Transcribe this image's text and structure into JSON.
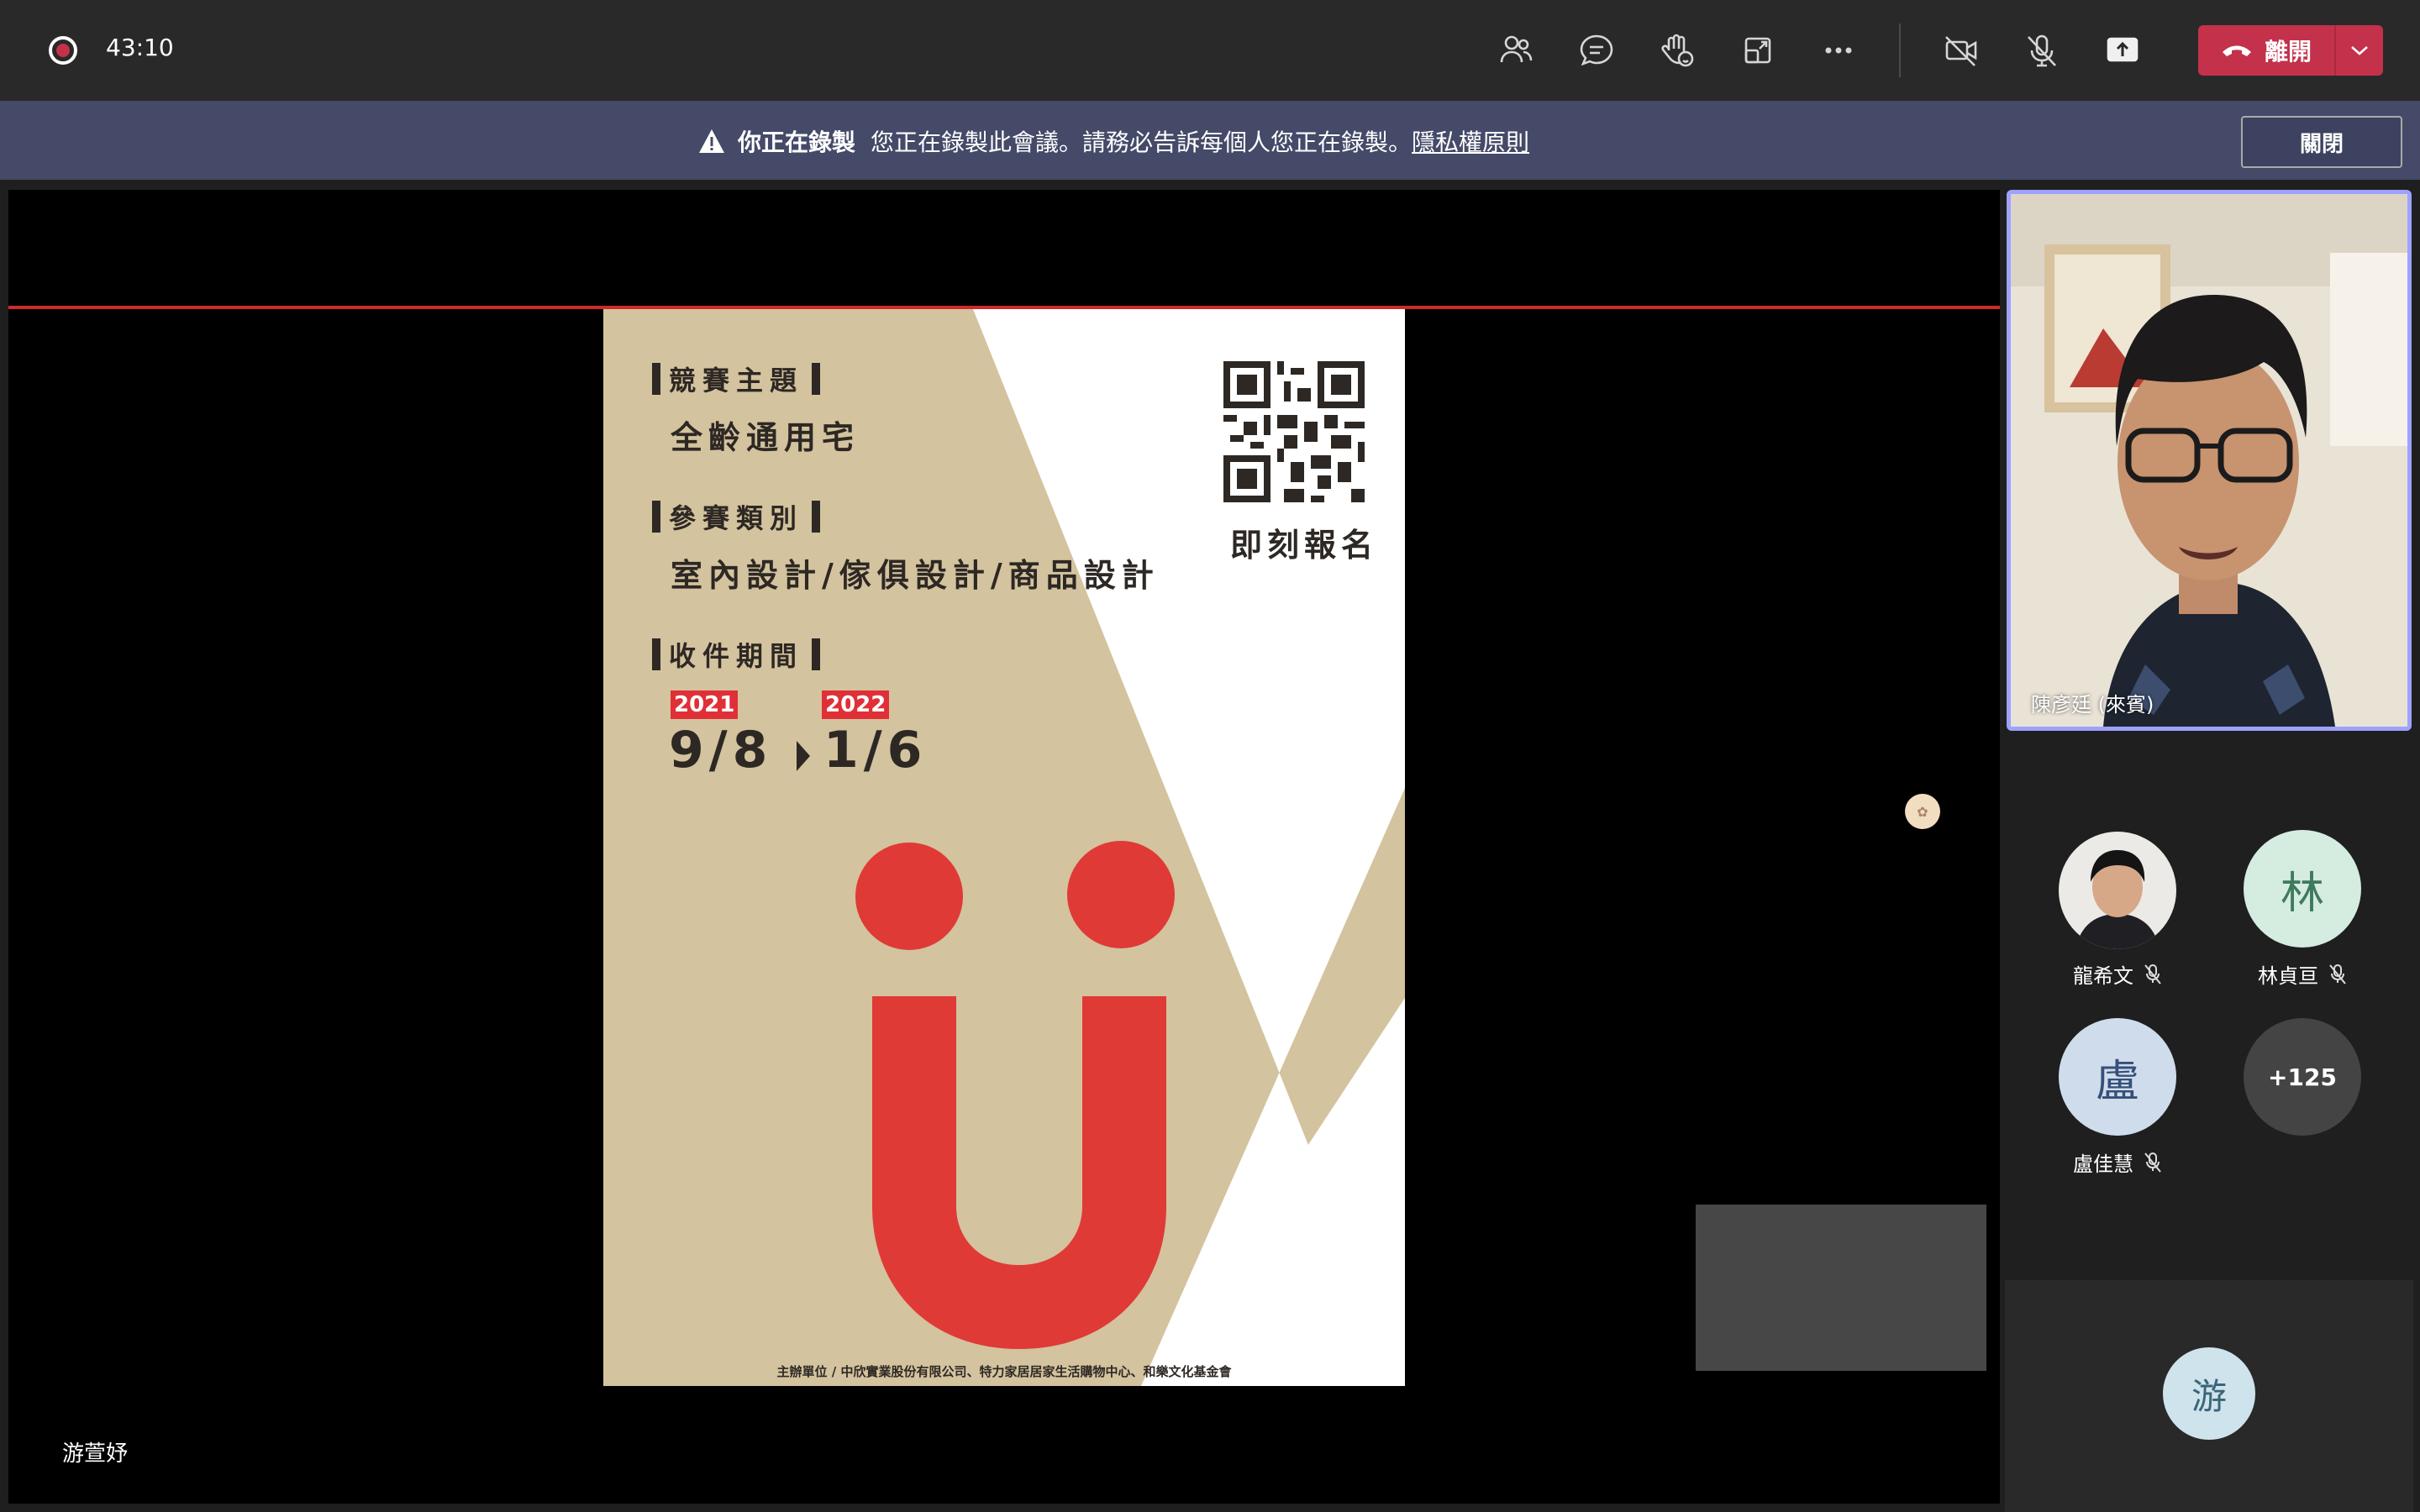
{
  "topbar": {
    "timer": "43:10",
    "leave_label": "離開",
    "icons": [
      "people-icon",
      "chat-icon",
      "raise-hand-icon",
      "share-tray-icon",
      "more-icon",
      "camera-off-icon",
      "mic-off-icon",
      "share-screen-icon"
    ]
  },
  "banner": {
    "title": "你正在錄製",
    "message": "您正在錄製此會議。請務必告訴每個人您正在錄製。",
    "link": "隱私權原則",
    "close_label": "關閉"
  },
  "poster": {
    "theme_heading": "競賽主題",
    "theme_value": "全齡通用宅",
    "category_heading": "參賽類別",
    "category_value": "室內設計/傢俱設計/商品設計",
    "period_heading": "收件期間",
    "start_year": "2021",
    "start_date": "9/8",
    "end_year": "2022",
    "end_date": "1/6",
    "signup": "即刻報名",
    "footer": "主辦單位 / 中欣實業股份有限公司、特力家居居家生活購物中心、和樂文化基金會",
    "colors": {
      "accent_red": "#e03a36",
      "background_beige": "#d3c39e"
    }
  },
  "stage": {
    "presenter_name": "游萱妤"
  },
  "participants": {
    "featured": {
      "name": "陳彥廷 (來賓)"
    },
    "gallery": [
      {
        "name": "龍希文",
        "initial": "",
        "muted": true
      },
      {
        "name": "林貞亘",
        "initial": "林",
        "muted": true
      },
      {
        "name": "盧佳慧",
        "initial": "盧",
        "muted": true
      },
      {
        "name": "",
        "initial": "+125",
        "muted": false
      }
    ],
    "bottom_initial": "游"
  }
}
